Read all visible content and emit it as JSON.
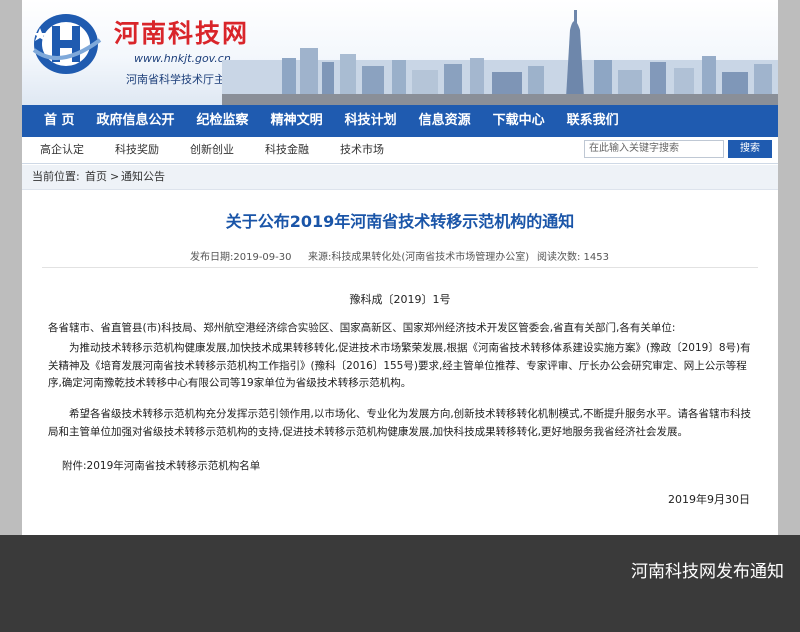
{
  "header": {
    "site_name": "河南科技网",
    "url": "www.hnkjt.gov.cn",
    "organizer": "河南省科学技术厅主办"
  },
  "nav": {
    "items": [
      "首 页",
      "政府信息公开",
      "纪检监察",
      "精神文明",
      "科技计划",
      "信息资源",
      "下载中心",
      "联系我们"
    ]
  },
  "subnav": {
    "items": [
      "高企认定",
      "科技奖励",
      "创新创业",
      "科技金融",
      "技术市场"
    ]
  },
  "search": {
    "placeholder": "在此输入关键字搜索",
    "button": "搜索"
  },
  "breadcrumb": {
    "label": "当前位置:",
    "home": "首页",
    "separator": ">",
    "current": "通知公告"
  },
  "article": {
    "title": "关于公布2019年河南省技术转移示范机构的通知",
    "publish_date": "发布日期:2019-09-30",
    "source": "来源:科技成果转化处(河南省技术市场管理办公室)",
    "views": "阅读次数: 1453",
    "doc_number": "豫科成〔2019〕1号",
    "salutation": "各省辖市、省直管县(市)科技局、郑州航空港经济综合实验区、国家高新区、国家郑州经济技术开发区管委会,省直有关部门,各有关单位:",
    "para1": "为推动技术转移示范机构健康发展,加快技术成果转移转化,促进技术市场繁荣发展,根据《河南省技术转移体系建设实施方案》(豫政〔2019〕8号)有关精神及《培育发展河南省技术转移示范机构工作指引》(豫科〔2016〕155号)要求,经主管单位推荐、专家评审、厅长办公会研究审定、网上公示等程序,确定河南豫乾技术转移中心有限公司等19家单位为省级技术转移示范机构。",
    "para2": "希望各省级技术转移示范机构充分发挥示范引领作用,以市场化、专业化为发展方向,创新技术转移转化机制模式,不断提升服务水平。请各省辖市科技局和主管单位加强对省级技术转移示范机构的支持,促进技术转移示范机构健康发展,加快科技成果转移转化,更好地服务我省经济社会发展。",
    "attachment": "附件:2019年河南省技术转移示范机构名单",
    "date": "2019年9月30日"
  },
  "caption": "河南科技网发布通知",
  "colors": {
    "nav_blue": "#1f5bb0",
    "title_blue": "#1a55a8",
    "logo_red": "#d9252a"
  }
}
